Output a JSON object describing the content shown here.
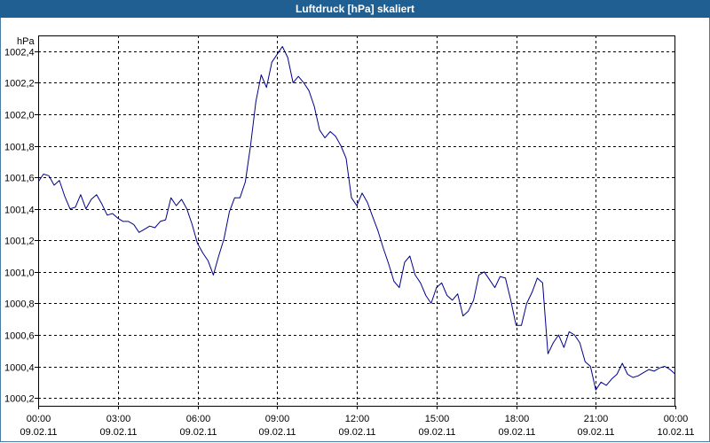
{
  "window": {
    "title": "Luftdruck [hPa] skaliert"
  },
  "chart_data": {
    "type": "line",
    "title": "Luftdruck [hPa] skaliert",
    "ylabel": "hPa",
    "xlabel": "",
    "ylim": [
      1000.15,
      1002.5
    ],
    "xlim_hours": [
      0,
      24
    ],
    "grid": true,
    "y_ticks": [
      {
        "value": 1000.2,
        "label": "1000,2"
      },
      {
        "value": 1000.4,
        "label": "1000,4"
      },
      {
        "value": 1000.6,
        "label": "1000,6"
      },
      {
        "value": 1000.8,
        "label": "1000,8"
      },
      {
        "value": 1001.0,
        "label": "1001,0"
      },
      {
        "value": 1001.2,
        "label": "1001,2"
      },
      {
        "value": 1001.4,
        "label": "1001,4"
      },
      {
        "value": 1001.6,
        "label": "1001,6"
      },
      {
        "value": 1001.8,
        "label": "1001,8"
      },
      {
        "value": 1002.0,
        "label": "1002,0"
      },
      {
        "value": 1002.2,
        "label": "1002,2"
      },
      {
        "value": 1002.4,
        "label": "1002,4"
      }
    ],
    "x_ticks": [
      {
        "hour": 0,
        "time": "00:00",
        "date": "09.02.11"
      },
      {
        "hour": 3,
        "time": "03:00",
        "date": "09.02.11"
      },
      {
        "hour": 6,
        "time": "06:00",
        "date": "09.02.11"
      },
      {
        "hour": 9,
        "time": "09:00",
        "date": "09.02.11"
      },
      {
        "hour": 12,
        "time": "12:00",
        "date": "09.02.11"
      },
      {
        "hour": 15,
        "time": "15:00",
        "date": "09.02.11"
      },
      {
        "hour": 18,
        "time": "18:00",
        "date": "09.02.11"
      },
      {
        "hour": 21,
        "time": "21:00",
        "date": "09.02.11"
      },
      {
        "hour": 24,
        "time": "00:00",
        "date": "10.02.11"
      }
    ],
    "series": [
      {
        "color": "#00008b",
        "x_hours": [
          0,
          0.2,
          0.4,
          0.6,
          0.8,
          1.0,
          1.2,
          1.4,
          1.6,
          1.8,
          2.0,
          2.2,
          2.4,
          2.6,
          2.8,
          3.0,
          3.2,
          3.4,
          3.6,
          3.8,
          4.0,
          4.2,
          4.4,
          4.6,
          4.8,
          5.0,
          5.2,
          5.4,
          5.6,
          5.8,
          6.0,
          6.2,
          6.4,
          6.6,
          6.8,
          7.0,
          7.2,
          7.4,
          7.6,
          7.8,
          8.0,
          8.2,
          8.4,
          8.6,
          8.8,
          9.0,
          9.2,
          9.4,
          9.6,
          9.8,
          10.0,
          10.2,
          10.4,
          10.6,
          10.8,
          11.0,
          11.2,
          11.4,
          11.6,
          11.8,
          12.0,
          12.2,
          12.4,
          12.6,
          12.8,
          13.0,
          13.2,
          13.4,
          13.6,
          13.8,
          14.0,
          14.2,
          14.4,
          14.6,
          14.8,
          15.0,
          15.2,
          15.4,
          15.6,
          15.8,
          16.0,
          16.2,
          16.4,
          16.6,
          16.8,
          17.0,
          17.2,
          17.4,
          17.6,
          17.8,
          18.0,
          18.2,
          18.4,
          18.6,
          18.8,
          19.0,
          19.2,
          19.4,
          19.6,
          19.8,
          20.0,
          20.2,
          20.4,
          20.6,
          20.8,
          21.0,
          21.2,
          21.4,
          21.6,
          21.8,
          22.0,
          22.2,
          22.4,
          22.6,
          22.8,
          23.0,
          23.2,
          23.4,
          23.6,
          23.8,
          24.0
        ],
        "values": [
          1001.57,
          1001.62,
          1001.61,
          1001.55,
          1001.58,
          1001.48,
          1001.4,
          1001.41,
          1001.49,
          1001.4,
          1001.46,
          1001.49,
          1001.43,
          1001.36,
          1001.37,
          1001.34,
          1001.32,
          1001.32,
          1001.3,
          1001.25,
          1001.27,
          1001.29,
          1001.28,
          1001.32,
          1001.33,
          1001.47,
          1001.42,
          1001.46,
          1001.4,
          1001.3,
          1001.18,
          1001.12,
          1001.07,
          1000.98,
          1001.1,
          1001.21,
          1001.38,
          1001.47,
          1001.47,
          1001.57,
          1001.8,
          1002.08,
          1002.25,
          1002.17,
          1002.33,
          1002.38,
          1002.43,
          1002.36,
          1002.2,
          1002.24,
          1002.2,
          1002.15,
          1002.05,
          1001.9,
          1001.85,
          1001.89,
          1001.86,
          1001.8,
          1001.72,
          1001.47,
          1001.42,
          1001.5,
          1001.44,
          1001.35,
          1001.26,
          1001.15,
          1001.05,
          1000.94,
          1000.9,
          1001.06,
          1001.1,
          1000.98,
          1000.93,
          1000.85,
          1000.8,
          1000.9,
          1000.93,
          1000.85,
          1000.82,
          1000.86,
          1000.72,
          1000.75,
          1000.82,
          1000.98,
          1001.0,
          1000.95,
          1000.9,
          1000.97,
          1000.96,
          1000.82,
          1000.66,
          1000.66,
          1000.8,
          1000.87,
          1000.96,
          1000.93,
          1000.48,
          1000.55,
          1000.6,
          1000.52,
          1000.62,
          1000.6,
          1000.55,
          1000.43,
          1000.4,
          1000.25,
          1000.3,
          1000.28,
          1000.32,
          1000.35,
          1000.42,
          1000.35,
          1000.33,
          1000.34,
          1000.36,
          1000.38,
          1000.37,
          1000.39,
          1000.4,
          1000.38,
          1000.35
        ]
      }
    ]
  }
}
